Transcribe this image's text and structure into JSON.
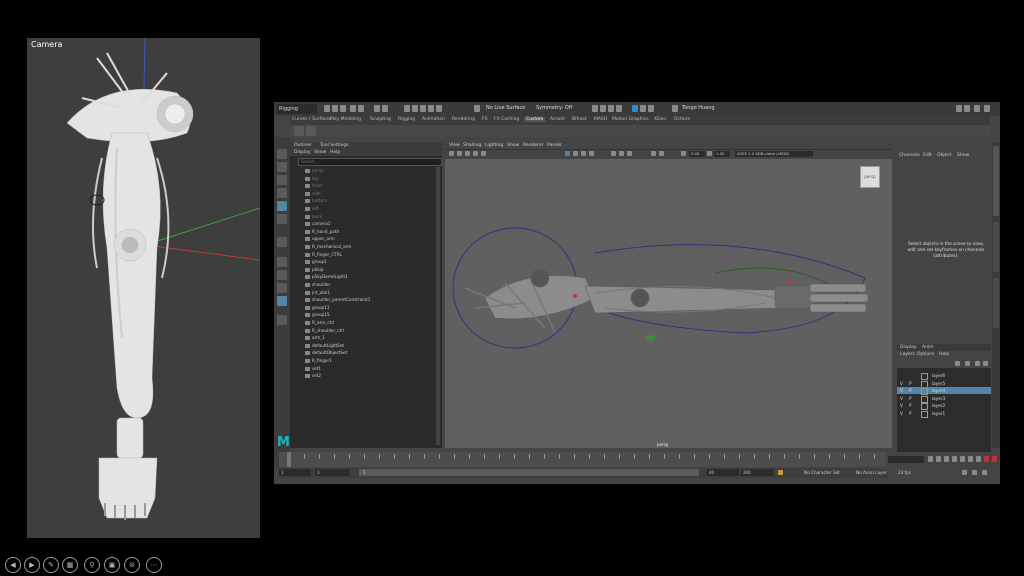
{
  "camera_panel": {
    "label": "Camera"
  },
  "maya": {
    "menu_set": "Rigging",
    "toolbar": {
      "surface_live": "No Live Surface",
      "symmetry": "Symmetry: Off",
      "user": "Tongo Huang"
    },
    "shelf_tabs": [
      "Curves / Surfaces",
      "Poly Modeling",
      "Sculpting",
      "Rigging",
      "Animation",
      "Rendering",
      "FX",
      "FX Caching",
      "Custom",
      "Arnold",
      "Bifrost",
      "MASH",
      "Motion Graphics",
      "XGen",
      "Octane"
    ],
    "active_shelf": "Custom",
    "outliner": {
      "tabs": [
        "Outliner",
        "Tool Settings"
      ],
      "menu": [
        "Display",
        "Show",
        "Help"
      ],
      "search_placeholder": "Search...",
      "items": [
        {
          "name": "persp",
          "dim": true
        },
        {
          "name": "top",
          "dim": true
        },
        {
          "name": "front",
          "dim": true
        },
        {
          "name": "side",
          "dim": true
        },
        {
          "name": "bottom",
          "dim": true
        },
        {
          "name": "left",
          "dim": true
        },
        {
          "name": "back",
          "dim": true
        },
        {
          "name": "camera1",
          "dim": false
        },
        {
          "name": "R_hand_path",
          "dim": false
        },
        {
          "name": "upper_arm",
          "dim": false
        },
        {
          "name": "R_mechanical_arm",
          "dim": false
        },
        {
          "name": "R_finger_CTRL",
          "dim": false
        },
        {
          "name": "group1",
          "dim": false
        },
        {
          "name": "pSkip",
          "dim": false
        },
        {
          "name": "pSkyDomeLight1",
          "dim": false
        },
        {
          "name": "shoulder",
          "dim": false
        },
        {
          "name": "jnt_abe1",
          "dim": false
        },
        {
          "name": "shoulder_parentConstraint1",
          "dim": false
        },
        {
          "name": "group11",
          "dim": false
        },
        {
          "name": "group15",
          "dim": false
        },
        {
          "name": "R_arm_ctrl",
          "dim": false
        },
        {
          "name": "R_shoulder_ctrl",
          "dim": false
        },
        {
          "name": "arm_1",
          "dim": false
        },
        {
          "name": "defaultLightSet",
          "dim": false
        },
        {
          "name": "defaultObjectSet",
          "dim": false
        },
        {
          "name": "R_finger1",
          "dim": false
        },
        {
          "name": "set1",
          "dim": false
        },
        {
          "name": "set2",
          "dim": false
        }
      ]
    },
    "viewport": {
      "menu": [
        "View",
        "Shading",
        "Lighting",
        "Show",
        "Renderer",
        "Panels"
      ],
      "field_a": "0.00",
      "field_b": "1.00",
      "color_space": "ACES 1.0 SDR-video (sRGB)",
      "camera_name": "persp",
      "viewcube_label": "persp"
    },
    "channel_box": {
      "menu": [
        "Channels",
        "Edit",
        "Object",
        "Show"
      ],
      "message": "Select objects in the scene to view, edit and set keyframes on channels (attributes)."
    },
    "layers": {
      "tabs": [
        "Display",
        "Anim"
      ],
      "menu": [
        "Layers",
        "Options",
        "Help"
      ],
      "rows": [
        {
          "v": "",
          "p": "",
          "name": "layer6",
          "selected": false
        },
        {
          "v": "V",
          "p": "P",
          "name": "layer5",
          "selected": false
        },
        {
          "v": "V",
          "p": "P",
          "name": "layer4",
          "selected": true
        },
        {
          "v": "V",
          "p": "P",
          "name": "layer3",
          "selected": false
        },
        {
          "v": "V",
          "p": "P",
          "name": "layer2",
          "selected": false
        },
        {
          "v": "V",
          "p": "P",
          "name": "layer1",
          "selected": false
        }
      ]
    },
    "side_tabs": [
      "Channel Box / Layer Editor",
      "Attribute Editor",
      "Modeling Toolkit"
    ],
    "time": {
      "start": "1",
      "playback_start": "1",
      "range_label": "1",
      "playback_end": "40",
      "end": "200",
      "character_set": "No Character Set",
      "anim_layer": "No Anim Layer",
      "fps": "24 fps"
    }
  },
  "presentation_toolbar": [
    "prev",
    "next",
    "pen",
    "slides",
    "zoom",
    "subtitles",
    "camera-off",
    "more"
  ]
}
